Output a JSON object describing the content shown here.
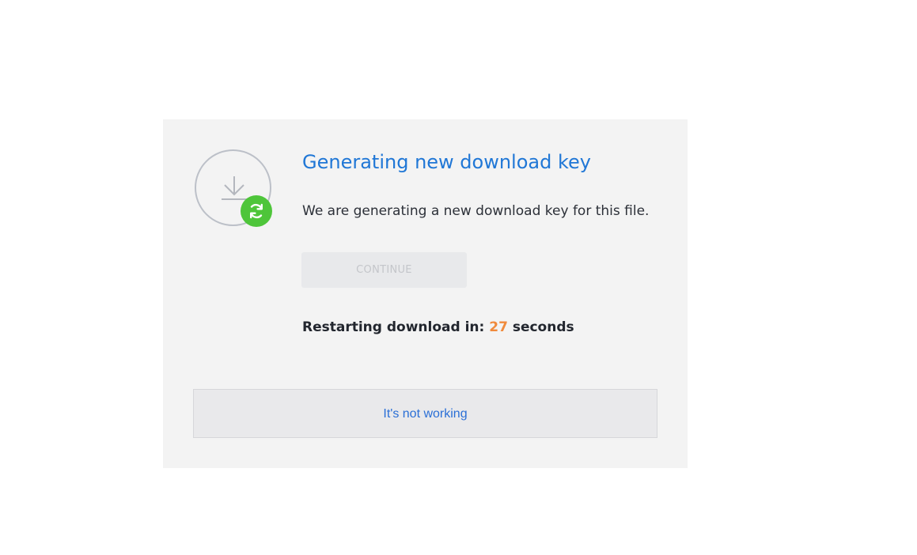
{
  "dialog": {
    "title": "Generating new download key",
    "description": "We are generating a new download key for this file.",
    "continue_label": "CONTINUE",
    "countdown_prefix": "Restarting download in: ",
    "countdown_value": "27",
    "countdown_suffix": " seconds",
    "help_link": "It's not working"
  },
  "icons": {
    "main": "download-icon",
    "badge": "refresh-icon"
  },
  "colors": {
    "accent": "#2077d6",
    "badge": "#4ec53a",
    "countdown": "#f08a3c",
    "panel": "#f3f3f3"
  }
}
